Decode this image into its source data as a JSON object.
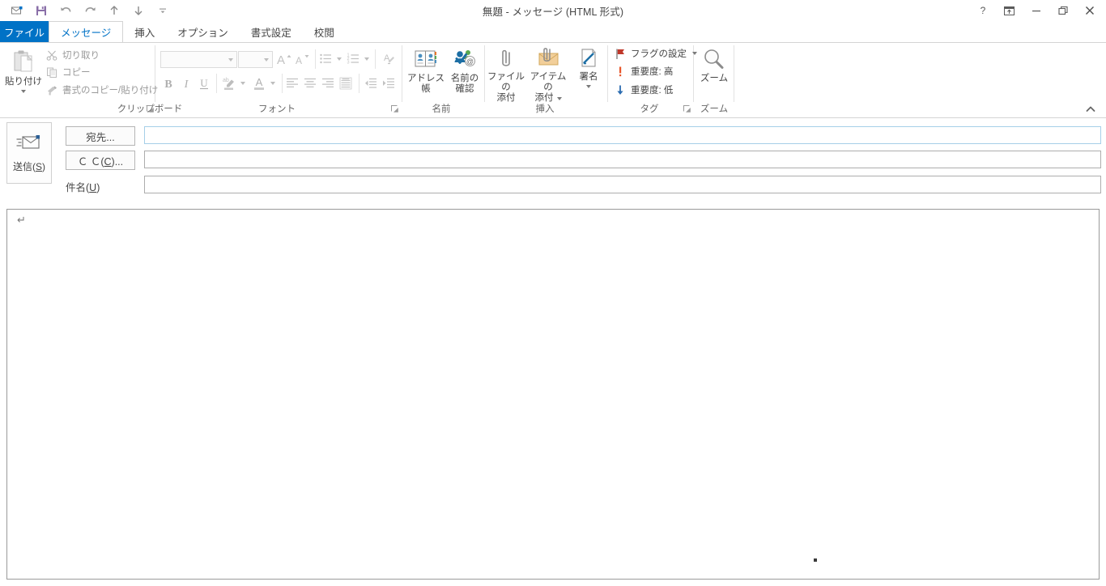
{
  "window": {
    "title": "無題 - メッセージ (HTML 形式)",
    "help_label": "?",
    "ribbon_display_label": "リボンの表示オプション",
    "minimize_label": "最小化",
    "restore_label": "元に戻す (縮小)",
    "close_label": "閉じる"
  },
  "quick_access": {
    "items": [
      {
        "name": "new-message-icon",
        "label": "新しいメッセージ"
      },
      {
        "name": "save-icon",
        "label": "上書き保存"
      },
      {
        "name": "undo-icon",
        "label": "元に戻す"
      },
      {
        "name": "redo-icon",
        "label": "やり直し"
      },
      {
        "name": "previous-item-icon",
        "label": "前のアイテム"
      },
      {
        "name": "next-item-icon",
        "label": "次のアイテム"
      },
      {
        "name": "customize-qat-icon",
        "label": "クイック アクセス ツール バーのユーザー設定"
      }
    ]
  },
  "tabs": {
    "file": "ファイル",
    "items": [
      {
        "label": "メッセージ",
        "active": true
      },
      {
        "label": "挿入",
        "active": false
      },
      {
        "label": "オプション",
        "active": false
      },
      {
        "label": "書式設定",
        "active": false
      },
      {
        "label": "校閲",
        "active": false
      }
    ]
  },
  "ribbon": {
    "collapse_label": "リボンを折りたたむ",
    "groups": [
      {
        "name": "clipboard",
        "label": "クリップボード",
        "paste": "貼り付け",
        "cut": "切り取り",
        "copy": "コピー",
        "format_painter": "書式のコピー/貼り付け"
      },
      {
        "name": "font",
        "label": "フォント",
        "font_name_value": "",
        "font_size_value": "",
        "grow_font": "フォント サイズの拡大",
        "shrink_font": "フォント サイズの縮小",
        "bullets": "箇条書き",
        "numbering": "段落番号",
        "clear_formatting": "すべての書式をクリア",
        "bold": "B",
        "italic": "I",
        "underline": "U",
        "text_highlight": "蛍光ペンの色",
        "font_color": "フォントの色",
        "align_left": "左揃え",
        "align_center": "中央揃え",
        "align_right": "右揃え",
        "justify": "両端揃え",
        "decrease_indent": "インデントを減らす",
        "increase_indent": "インデントを増やす"
      },
      {
        "name": "names",
        "label": "名前",
        "address_book": "アドレス帳",
        "check_names_line1": "名前の",
        "check_names_line2": "確認"
      },
      {
        "name": "include",
        "label": "挿入",
        "attach_file_line1": "ファイルの",
        "attach_file_line2": "添付",
        "attach_item_line1": "アイテムの",
        "attach_item_line2": "添付",
        "signature": "署名"
      },
      {
        "name": "tags",
        "label": "タグ",
        "follow_up": "フラグの設定",
        "high_importance": "重要度: 高",
        "low_importance": "重要度: 低"
      },
      {
        "name": "zoom",
        "label": "ズーム",
        "zoom_button": "ズーム"
      }
    ]
  },
  "compose": {
    "send_button": "送信(S)",
    "to_button": "宛先...",
    "cc_button": "Ｃ Ｃ(C)...",
    "subject_label": "件名(U)",
    "to_value": "",
    "cc_value": "",
    "subject_value": "",
    "to_placeholder": "",
    "cc_placeholder": "",
    "subject_placeholder": "",
    "body_value": "",
    "body_paragraph_mark": "↵"
  },
  "colors": {
    "accent": "#0072c6",
    "tab_active_text": "#0072c6",
    "field_focus_border": "#a6cfe8",
    "flag_red": "#c0392b",
    "importance_high": "#e8562a",
    "importance_low": "#2b6cb0",
    "text": "#444444",
    "disabled_text": "#9a9a9a"
  }
}
